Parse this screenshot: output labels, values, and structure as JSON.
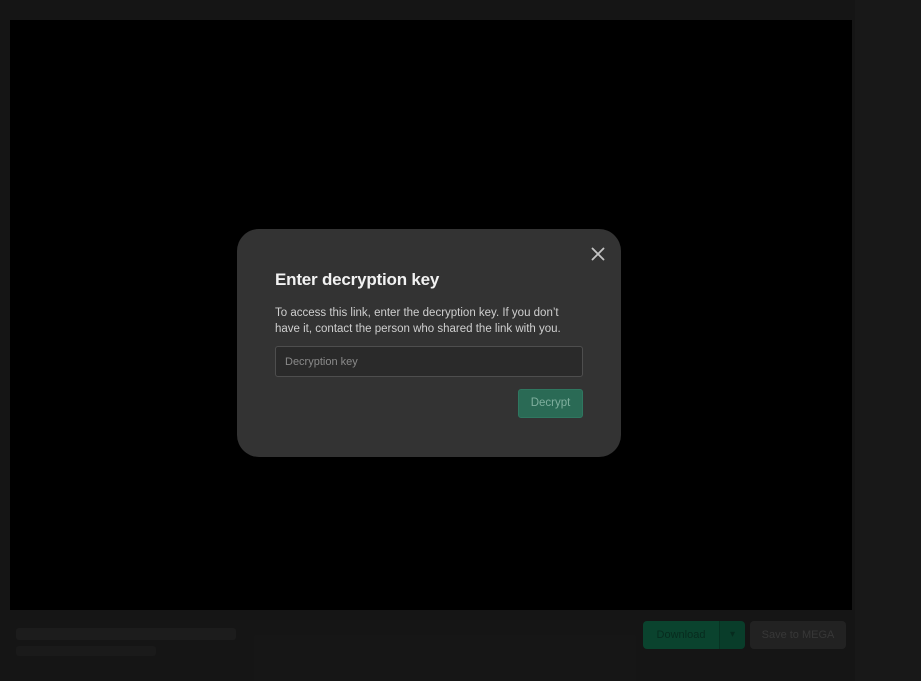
{
  "footer": {
    "download_label": "Download",
    "save_label": "Save to MEGA"
  },
  "dialog": {
    "title": "Enter decryption key",
    "description": "To access this link, enter the decryption key. If you don’t have it, contact the person who shared the link with you.",
    "input": {
      "value": "",
      "placeholder": "Decryption key"
    },
    "decrypt_label": "Decrypt",
    "close_icon": "close-icon"
  },
  "colors": {
    "modal_bg": "#333333",
    "accent": "#2a6a55",
    "viewer_bg": "#000000"
  }
}
